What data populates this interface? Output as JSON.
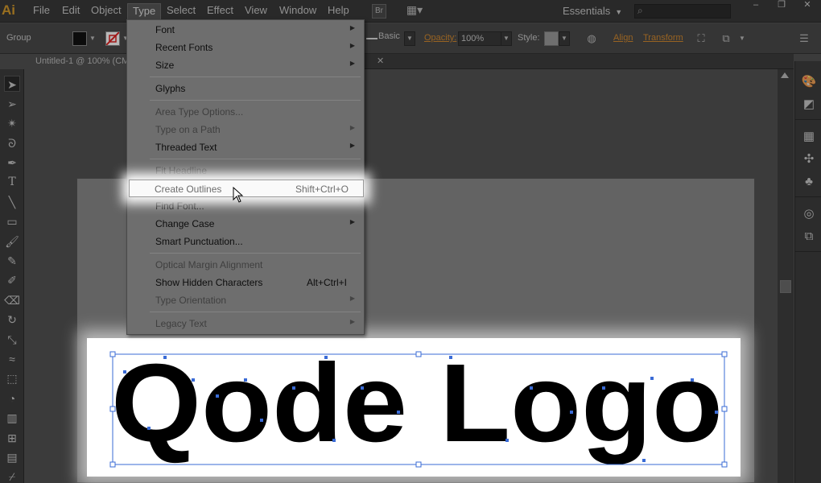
{
  "app": {
    "logo": "Ai",
    "accent": "#d59a2b"
  },
  "menubar": {
    "items": [
      "File",
      "Edit",
      "Object",
      "Type",
      "Select",
      "Effect",
      "View",
      "Window",
      "Help"
    ],
    "bridge_btn": "Br",
    "workspace": "Essentials",
    "window_controls": [
      "–",
      "❐",
      "✕"
    ]
  },
  "controlbar": {
    "selection": "Group",
    "stroke_profile": "Basic",
    "opacity_label": "Opacity:",
    "opacity_value": "100%",
    "style_label": "Style:",
    "align": "Align",
    "transform": "Transform"
  },
  "document": {
    "tab_title": "Untitled-1 @ 100% (CMYK/Preview)",
    "artwork_text": "Qode Logo"
  },
  "type_menu": {
    "items": [
      {
        "label": "Font",
        "submenu": true,
        "disabled": false
      },
      {
        "label": "Recent Fonts",
        "submenu": true,
        "disabled": false
      },
      {
        "label": "Size",
        "submenu": true,
        "disabled": false
      },
      {
        "label": "Glyphs",
        "disabled": false
      },
      {
        "label": "Area Type Options...",
        "disabled": true
      },
      {
        "label": "Type on a Path",
        "submenu": true,
        "disabled": true
      },
      {
        "label": "Threaded Text",
        "submenu": true,
        "disabled": false
      },
      {
        "label": "Fit Headline",
        "disabled": true
      },
      {
        "label": "Create Outlines",
        "shortcut": "Shift+Ctrl+O",
        "highlighted": true
      },
      {
        "label": "Find Font...",
        "disabled": false
      },
      {
        "label": "Change Case",
        "submenu": true,
        "disabled": false
      },
      {
        "label": "Smart Punctuation...",
        "disabled": false
      },
      {
        "label": "Optical Margin Alignment",
        "disabled": true
      },
      {
        "label": "Show Hidden Characters",
        "shortcut": "Alt+Ctrl+I",
        "disabled": false
      },
      {
        "label": "Type Orientation",
        "submenu": true,
        "disabled": true
      },
      {
        "label": "Legacy Text",
        "submenu": true,
        "disabled": true
      }
    ]
  },
  "icons": {
    "tools": [
      "selection-icon",
      "direct-selection-icon",
      "magic-wand-icon",
      "lasso-icon",
      "pen-icon",
      "type-icon",
      "line-segment-icon",
      "rectangle-icon",
      "paintbrush-icon",
      "pencil-icon",
      "blob-brush-icon",
      "eraser-icon",
      "rotate-icon",
      "scale-icon",
      "width-icon",
      "free-transform-icon",
      "shape-builder-icon",
      "perspective-grid-icon",
      "mesh-icon",
      "gradient-icon",
      "eyedropper-icon"
    ],
    "panels": [
      "color-icon",
      "color-guide-icon",
      "swatches-icon",
      "brushes-icon",
      "symbols-icon",
      "appearance-icon",
      "graphic-styles-icon"
    ]
  }
}
